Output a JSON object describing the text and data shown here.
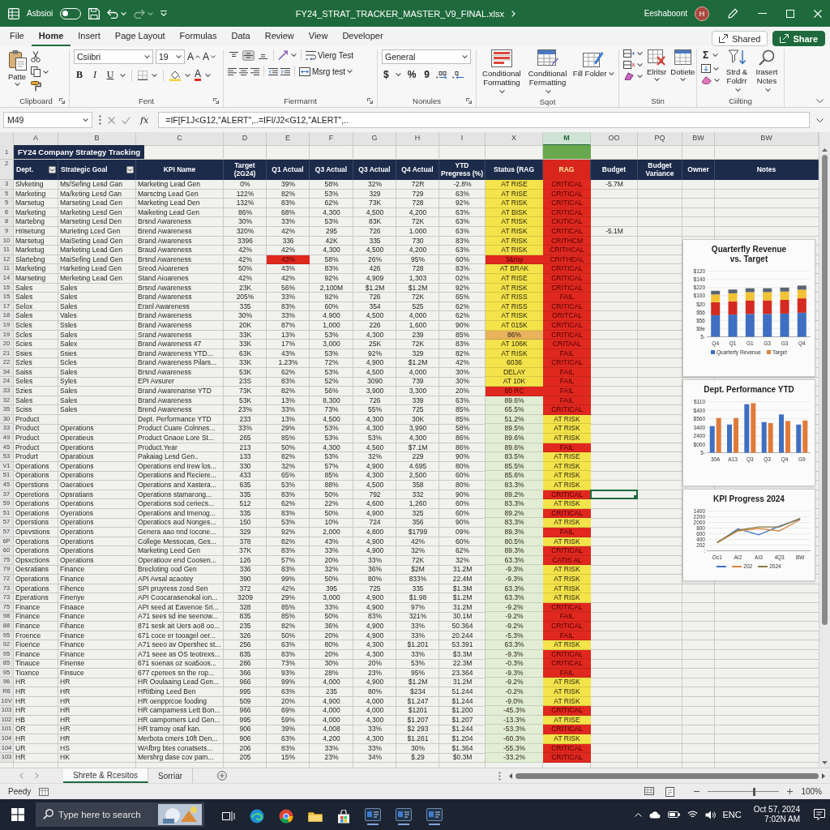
{
  "title_bar": {
    "autosave_label": "Asbsioi",
    "autosave_on": false,
    "file_name": "FY24_STRAT_TRACKER_MASTER_V9_FINAL.xlsx",
    "user_name": "Eeshaboont",
    "avatar_initial": "H"
  },
  "ribbon": {
    "tabs": [
      {
        "label": "File",
        "selected": false
      },
      {
        "label": "Home",
        "selected": true
      },
      {
        "label": "Insert",
        "selected": false
      },
      {
        "label": "Page Layout",
        "selected": false
      },
      {
        "label": "Formulas",
        "selected": false
      },
      {
        "label": "Data",
        "selected": false
      },
      {
        "label": "Review",
        "selected": false
      },
      {
        "label": "View",
        "selected": false
      },
      {
        "label": "Developer",
        "selected": false
      }
    ],
    "shared_label": "Shared",
    "share_label": "Share",
    "clipboard": {
      "label": "Clipboard",
      "paste_label": "Patte"
    },
    "font": {
      "label": "Fent",
      "font_name": "Csiibri",
      "font_size": "19",
      "grow_label": "A",
      "shrink_label": "A",
      "style_buttons": [
        "B",
        "I",
        "U"
      ],
      "color_label": "A"
    },
    "alignment": {
      "label": "Fiermarnt",
      "vertical_options": [
        {
          "selected": false
        },
        {
          "selected": true
        },
        {
          "selected": false
        }
      ],
      "wrap_label": "Vierg Test",
      "merge_label": "Msrg test"
    },
    "number": {
      "label": "Nonules",
      "format": "General",
      "symbols": [
        "$",
        "%",
        "9"
      ]
    },
    "styles": {
      "label": "Sqot",
      "buttons": [
        "Conditional Formatting",
        "Conditional Fermatting",
        "Fill Folder"
      ]
    },
    "cells": {
      "label": "Stin",
      "buttons": [
        "Elritsr",
        "Dotiete"
      ]
    },
    "editing": {
      "label": "Ciilting",
      "sum_label": "Σ",
      "buttons": [
        "Strd & Foldrr",
        "Irasert Nctes"
      ]
    }
  },
  "formula_bar": {
    "name_box": "M49",
    "fx_label": "fx",
    "formula": "=IF[F1J<G12,\"ALERT\",..=IFI/J2<G12,\"ALERT\",.."
  },
  "sheet": {
    "columns": [
      {
        "letter": "A",
        "selected": false
      },
      {
        "letter": "B",
        "selected": false
      },
      {
        "letter": "C",
        "selected": false
      },
      {
        "letter": "D",
        "selected": false
      },
      {
        "letter": "E",
        "selected": false
      },
      {
        "letter": "F",
        "selected": false
      },
      {
        "letter": "G",
        "selected": false
      },
      {
        "letter": "H",
        "selected": false
      },
      {
        "letter": "I",
        "selected": false
      },
      {
        "letter": "X",
        "selected": false
      },
      {
        "letter": "M",
        "selected": true
      },
      {
        "letter": "OO",
        "selected": false
      },
      {
        "letter": "PQ",
        "selected": false
      },
      {
        "letter": "BW",
        "selected": false
      },
      {
        "letter": "BW",
        "selected": false
      }
    ],
    "title_row": {
      "row_number": "1",
      "title": "FY24 Company Strategy Tracking"
    },
    "header_row": {
      "row_number": "2",
      "headers": [
        {
          "label": "Dept.",
          "filter": true,
          "color": "#1c2b4a"
        },
        {
          "label": "Strategic Goal",
          "filter": true,
          "color": "#1c2b4a"
        },
        {
          "label": "KPI Name",
          "filter": false,
          "color": "#1c2b4a"
        },
        {
          "label": "Target (2G24)",
          "filter": false,
          "color": "#1c2b4a"
        },
        {
          "label": "Q1 Actual",
          "filter": false,
          "color": "#1c2b4a"
        },
        {
          "label": "Q3 Actual",
          "filter": false,
          "color": "#1c2b4a"
        },
        {
          "label": "Q3 Actual",
          "filter": false,
          "color": "#1c2b4a"
        },
        {
          "label": "Q4 Actual",
          "filter": false,
          "color": "#1c2b4a"
        },
        {
          "label": "YTD Pregress (%)",
          "filter": false,
          "color": "#1c2b4a"
        },
        {
          "label": "Status (RAG",
          "filter": false,
          "color": "#1c2b4a"
        },
        {
          "label": "RAG",
          "filter": false,
          "color": "#d8261d"
        },
        {
          "label": "Budget",
          "filter": false,
          "color": "#1c2b4a"
        },
        {
          "label": "Budget Variance",
          "filter": false,
          "color": "#1c2b4a"
        },
        {
          "label": "Owner",
          "filter": false,
          "color": "#1c2b4a"
        },
        {
          "label": "Notes",
          "filter": false,
          "color": "#1c2b4a"
        }
      ]
    },
    "rows": [
      {
        "row_number": "3",
        "cells": [
          "Slvketing",
          "Ms/Sefing Lesd Gan",
          "Marketing Lead Gen",
          "0%",
          "39%",
          "58%",
          "32%",
          "72R",
          "-2.8%"
        ],
        "status": {
          "text": "AT RISE",
          "color": "#f4e34a"
        },
        "rag": {
          "text": "CRITICAL",
          "color": "#e0281f"
        },
        "budget": "-5.7M",
        "selected": false
      },
      {
        "row_number": "5",
        "cells": [
          "Marketing",
          "Ma/keting Lesd Gan",
          "Marsctng Lead Gen",
          "122%",
          "82%",
          "53%",
          "329",
          "729",
          "63%"
        ],
        "status": {
          "text": "AT RISE",
          "color": "#f4e34a"
        },
        "rag": {
          "text": "CRITICAL",
          "color": "#e0281f"
        },
        "selected": false
      },
      {
        "row_number": "5",
        "cells": [
          "Marsetug",
          "Marseting Lead Gen",
          "Marketing Lead Den",
          "132%",
          "83%",
          "62%",
          "73K",
          "728",
          "92%"
        ],
        "status": {
          "text": "AT RISK",
          "color": "#f4e34a"
        },
        "rag": {
          "text": "CRITICAL",
          "color": "#e0281f"
        },
        "selected": false
      },
      {
        "row_number": "6",
        "cells": [
          "Marketing",
          "Marketing Lesd Gen",
          "Maiketing Lead Gen",
          "86%",
          "68%",
          "4,300",
          "4,500",
          "4,200",
          "63%"
        ],
        "status": {
          "text": "AT BISK",
          "color": "#f4e34a"
        },
        "rag": {
          "text": "CRITICAL",
          "color": "#e0281f"
        },
        "selected": false
      },
      {
        "row_number": "8",
        "cells": [
          "Martebng",
          "Marseting Lesd Den",
          "Brsnd Awareness",
          "30%",
          "33%",
          "53%",
          "83K",
          "72K",
          "63%"
        ],
        "status": {
          "text": "AT RISK",
          "color": "#f4e34a"
        },
        "rag": {
          "text": "CKITICAL",
          "color": "#e0281f"
        },
        "selected": false
      },
      {
        "row_number": "9",
        "cells": [
          "Hrisetung",
          "Murieting Lced Gen",
          "Brend Awareness",
          "320%",
          "42%",
          "295",
          "726",
          "1.000",
          "63%"
        ],
        "status": {
          "text": "AT RISK",
          "color": "#f4e34a"
        },
        "rag": {
          "text": "CRITICAL",
          "color": "#e0281f"
        },
        "budget": "-5.1M",
        "selected": false
      },
      {
        "row_number": "10",
        "cells": [
          "Marsetug",
          "MaiSeting Lead Gen",
          "Brand Awareness",
          "3396",
          "336",
          "42K",
          "335",
          "730",
          "83%"
        ],
        "status": {
          "text": "AT RISK",
          "color": "#f4e34a"
        },
        "rag": {
          "text": "CRITHCM",
          "color": "#e0281f"
        },
        "selected": false
      },
      {
        "row_number": "11",
        "cells": [
          "Marketug",
          "Marketing Lead Gen",
          "Braud Awareness",
          "42%",
          "42%",
          "4,300",
          "4,500",
          "4,200",
          "63%"
        ],
        "status": {
          "text": "AT RISK",
          "color": "#f4e34a"
        },
        "rag": {
          "text": "CRITHCAL",
          "color": "#e0281f"
        },
        "selected": false
      },
      {
        "row_number": "12",
        "cells": [
          "Slartebng",
          "MaiSefing Lead Gen",
          "Brsnd Awareness",
          "42%",
          {
            "text": "43%",
            "color": "#e0281f"
          },
          "58%",
          "26%",
          "95%",
          "60%"
        ],
        "status": {
          "text": "3&roy",
          "color": "#e0281f"
        },
        "rag": {
          "text": "CRITHEAL",
          "color": "#e0281f"
        },
        "selected": false
      },
      {
        "row_number": "11",
        "cells": [
          "Marketing",
          "Harketing Lead Gen",
          "Sreod Aioarenes",
          "50%",
          "43%",
          "83%",
          "426",
          "728",
          "83%"
        ],
        "status": {
          "text": "AT BRAK",
          "color": "#f4e34a"
        },
        "rag": {
          "text": "CRITICAL",
          "color": "#e0281f"
        },
        "selected": false
      },
      {
        "row_number": "14",
        "cells": [
          "Marseting",
          "Merketing Lead Gen",
          "Stand Aioarenes",
          "42%",
          "42%",
          "92%",
          "4,909",
          "1,303",
          "02%"
        ],
        "status": {
          "text": "AT RISE",
          "color": "#f4e34a"
        },
        "rag": {
          "text": "CRITICAL",
          "color": "#e0281f"
        },
        "selected": false
      },
      {
        "row_number": "15",
        "cells": [
          "Sales",
          "Sales",
          "Brsnd Awareness",
          "23K",
          "56%",
          "2,100M",
          "$1.2M",
          "$1.2M",
          "92%"
        ],
        "status": {
          "text": "AT RISK",
          "color": "#f4e34a"
        },
        "rag": {
          "text": "CRITICAL",
          "color": "#e0281f"
        },
        "selected": false
      },
      {
        "row_number": "15",
        "cells": [
          "Sales",
          "Sales",
          "Brand Awareness",
          "205%",
          "33%",
          "92%",
          "726",
          "72K",
          "65%"
        ],
        "status": {
          "text": "AT RISS",
          "color": "#f4e34a"
        },
        "rag": {
          "text": "FAIL",
          "color": "#e0281f"
        },
        "selected": false
      },
      {
        "row_number": "17",
        "cells": [
          "Selox",
          "Sales",
          "Eranl Awareness",
          "335",
          "83%",
          "60%",
          "354",
          "525",
          "62%"
        ],
        "status": {
          "text": "AT RISS",
          "color": "#f4e34a"
        },
        "rag": {
          "text": "CRITICAL",
          "color": "#e0281f"
        },
        "selected": false
      },
      {
        "row_number": "18",
        "cells": [
          "Sales",
          "Vales",
          "Brand Awareness",
          "30%",
          "33%",
          "4.900",
          "4,500",
          "4,000",
          "62%"
        ],
        "status": {
          "text": "AT RISK",
          "color": "#f4e34a"
        },
        "rag": {
          "text": "ORITCAL",
          "color": "#e0281f"
        },
        "selected": false
      },
      {
        "row_number": "19",
        "cells": [
          "Scles",
          "Ssles",
          "Brand Awareness",
          "20K",
          "87%",
          "1,000",
          "226",
          "1,600",
          "90%"
        ],
        "status": {
          "text": "AT 015K",
          "color": "#f4e34a"
        },
        "rag": {
          "text": "CRITICAL",
          "color": "#e0281f"
        },
        "selected": false
      },
      {
        "row_number": "19",
        "cells": [
          "Scles",
          "Sales",
          "Srand Awareness",
          "33K",
          "13%",
          "53%",
          "4,300",
          "239",
          "85%"
        ],
        "status": {
          "text": "86%",
          "color": "#e9b25c"
        },
        "rag": {
          "text": "CRITICAL",
          "color": "#e0281f"
        },
        "selected": false
      },
      {
        "row_number": "20",
        "cells": [
          "Scies",
          "Salex",
          "Brand Awareness 47",
          "33K",
          "17%",
          "3,000",
          "25K",
          "72K",
          "83%"
        ],
        "status": {
          "text": "AT 106K",
          "color": "#f4e34a"
        },
        "rag": {
          "text": "CRITAAL",
          "color": "#e0281f"
        },
        "selected": false
      },
      {
        "row_number": "21",
        "cells": [
          "Ssies",
          "Ssies",
          "Brand Awareness YTD...",
          "63K",
          "43%",
          "53%",
          "92%",
          "329",
          "82%"
        ],
        "status": {
          "text": "AT RISK",
          "color": "#f4e34a"
        },
        "rag": {
          "text": "FAIL",
          "color": "#e0281f"
        },
        "selected": false
      },
      {
        "row_number": "22",
        "cells": [
          "Szles",
          "Scles",
          "Brand Awareness Pilars...",
          "33K",
          "1.23%",
          "72%",
          "4,900",
          "$1.2M",
          "42%"
        ],
        "status": {
          "text": "6036",
          "color": "#f4e34a"
        },
        "rag": {
          "text": "CRITICAL",
          "color": "#e0281f"
        },
        "selected": false
      },
      {
        "row_number": "34",
        "cells": [
          "Saiss",
          "Sales",
          "Brsnd Awareness",
          "53K",
          "62%",
          "53%",
          "4,500",
          "4,000",
          "30%"
        ],
        "status": {
          "text": "DELAY",
          "color": "#f4e34a"
        },
        "rag": {
          "text": "FAIL",
          "color": "#e0281f"
        },
        "selected": false
      },
      {
        "row_number": "24",
        "cells": [
          "Seles",
          "Syles",
          "EPI Avsurer",
          "23S",
          "83%",
          "52%",
          "3090",
          "739",
          "30%"
        ],
        "status": {
          "text": "AT 10K",
          "color": "#f4e34a"
        },
        "rag": {
          "text": "FAIL",
          "color": "#e0281f"
        },
        "selected": false
      },
      {
        "row_number": "33",
        "cells": [
          "Szies",
          "Sales",
          "Brand Awarenanse YTD",
          "73K",
          "82%",
          "56%",
          "3,900",
          "3,300",
          "20%"
        ],
        "status": {
          "text": "60 RC",
          "color": "#e0281f"
        },
        "rag": {
          "text": "FAIL",
          "color": "#e0281f"
        },
        "selected": false
      },
      {
        "row_number": "32",
        "cells": [
          "Sales",
          "Sales",
          "Brand Awareness",
          "53K",
          "13%",
          "8,300",
          "726",
          "339",
          "63%"
        ],
        "status": {
          "text": "89.6%",
          "color": "#e2edd6"
        },
        "rag": {
          "text": "FAIL",
          "color": "#e0281f"
        },
        "selected": false
      },
      {
        "row_number": "35",
        "cells": [
          "Sciss",
          "Sales",
          "Brend Awareness",
          "23%",
          "33%",
          "73%",
          "55%",
          "725",
          "85%"
        ],
        "status": {
          "text": "65.5%",
          "color": "#e2edd6"
        },
        "rag": {
          "text": "CRITICAL",
          "color": "#e0281f"
        },
        "selected": false
      },
      {
        "row_number": "30",
        "cells": [
          "Product",
          null,
          "Dept. Performance YTD",
          "233",
          "13%",
          "4,500",
          "4,300",
          "30K",
          "85%"
        ],
        "status": {
          "text": "51.2%",
          "color": "#e2edd6"
        },
        "rag": {
          "text": "AT RISK",
          "color": "#f4e34a"
        },
        "selected": false
      },
      {
        "row_number": "33",
        "cells": [
          "Product",
          "Operations",
          "Product Cuare Colnnes...",
          "33%",
          "29%",
          "53%",
          "4,300",
          "3,990",
          "58%"
        ],
        "status": {
          "text": "89.5%",
          "color": "#e2edd6"
        },
        "rag": {
          "text": "AT RISK",
          "color": "#f4e34a"
        },
        "selected": false
      },
      {
        "row_number": "49",
        "cells": [
          "Product",
          "Operatieus",
          "Product Gnaoe Lore St...",
          "265",
          "85%",
          "53%",
          "53%",
          "4,300",
          "86%"
        ],
        "status": {
          "text": "89.6%",
          "color": "#e2edd6"
        },
        "rag": {
          "text": "AT RISK",
          "color": "#f4e34a"
        },
        "selected": false
      },
      {
        "row_number": "45",
        "cells": [
          "Product",
          "Operations",
          "Product.Year",
          "213",
          "50%",
          "4,300",
          "4,560",
          "$7.1M",
          "86%"
        ],
        "status": {
          "text": "89.6%",
          "color": "#e2edd6"
        },
        "rag": {
          "text": "FAIL",
          "color": "#e0281f"
        },
        "selected": false
      },
      {
        "row_number": "53",
        "cells": [
          "Produrt",
          "Oparatious",
          "Pakaiag Lesd Gen..",
          "133",
          "82%",
          "53%",
          "32%",
          "229",
          "90%"
        ],
        "status": {
          "text": "83.5%",
          "color": "#e2edd6"
        },
        "rag": {
          "text": "AT RISE",
          "color": "#f4e34a"
        },
        "selected": false
      },
      {
        "row_number": "V1",
        "cells": [
          "Operations",
          "Operations",
          "Operations end Irew los...",
          "330",
          "32%",
          "57%",
          "4,900",
          "4.695",
          "80%"
        ],
        "status": {
          "text": "85.5%",
          "color": "#e2edd6"
        },
        "rag": {
          "text": "AT RISK",
          "color": "#f4e34a"
        },
        "selected": false
      },
      {
        "row_number": "51",
        "cells": [
          "Operations",
          "Operations",
          "Operations and Reciere...",
          "433",
          "65%",
          "85%",
          "4,300",
          "2,500",
          "60%"
        ],
        "status": {
          "text": "85.6%",
          "color": "#e2edd6"
        },
        "rag": {
          "text": "AT RISK",
          "color": "#f4e34a"
        },
        "selected": false
      },
      {
        "row_number": "45",
        "cells": [
          "Operstions",
          "Oaeratioes",
          "Operations and Xastera...",
          "635",
          "53%",
          "88%",
          "4,500",
          "358",
          "80%"
        ],
        "status": {
          "text": "83.3%",
          "color": "#e2edd6"
        },
        "rag": {
          "text": "AT RISK",
          "color": "#f4e34a"
        },
        "selected": false
      },
      {
        "row_number": "37",
        "cells": [
          "Operetions",
          "Opsratians",
          "Operations stamarong...",
          "335",
          "83%",
          "50%",
          "792",
          "332",
          "90%"
        ],
        "status": {
          "text": "89.2%",
          "color": "#e2edd6"
        },
        "rag": {
          "text": "CRITICAL",
          "color": "#e0281f"
        },
        "selected": true
      },
      {
        "row_number": "59",
        "cells": [
          "Operations",
          "Operations",
          "Operations sod ceriecs...",
          "512",
          "62%",
          "22%",
          "4,600",
          "1,260",
          "60%"
        ],
        "status": {
          "text": "83.3%",
          "color": "#e2edd6"
        },
        "rag": {
          "text": "AT RISK",
          "color": "#f4e34a"
        },
        "selected": false
      },
      {
        "row_number": "51",
        "cells": [
          "Operations",
          "Oyerations",
          "Operations and Imenog...",
          "335",
          "83%",
          "50%",
          "4,900",
          "325",
          "60%"
        ],
        "status": {
          "text": "89.2%",
          "color": "#e2edd6"
        },
        "rag": {
          "text": "CRITICAL",
          "color": "#e0281f"
        },
        "selected": false
      },
      {
        "row_number": "57",
        "cells": [
          "Operstions",
          "Operations",
          "Operatiocs aud Nonges...",
          "150",
          "53%",
          "10%",
          "724",
          "356",
          "90%"
        ],
        "status": {
          "text": "83.3%",
          "color": "#e2edd6"
        },
        "rag": {
          "text": "AT RISK",
          "color": "#f4e34a"
        },
        "selected": false
      },
      {
        "row_number": "57",
        "cells": [
          "Opevstions",
          "Operations",
          "Genera aao nnd Iocone...",
          "329",
          "92%",
          "2,000",
          "4,800",
          "$1799",
          "09%"
        ],
        "status": {
          "text": "89.3%",
          "color": "#e2edd6"
        },
        "rag": {
          "text": "FAIL",
          "color": "#e0281f"
        },
        "selected": false
      },
      {
        "row_number": "6P",
        "cells": [
          "Operations",
          "Operations",
          "College Messocas, Ges...",
          "378",
          "82%",
          "43%",
          "4,900",
          "42%",
          "60%"
        ],
        "status": {
          "text": "80.5%",
          "color": "#e2edd6"
        },
        "rag": {
          "text": "AT RISK",
          "color": "#f4e34a"
        },
        "selected": false
      },
      {
        "row_number": "60",
        "cells": [
          "Operations",
          "Operations",
          "Marketing Leed Gen",
          "37K",
          "83%",
          "33%",
          "4,900",
          "32%",
          "62%"
        ],
        "status": {
          "text": "89.3%",
          "color": "#e2edd6"
        },
        "rag": {
          "text": "CRITICAL",
          "color": "#e0281f"
        },
        "selected": false
      },
      {
        "row_number": "75",
        "cells": [
          "Opsxctions",
          "Operations",
          "Operatioov end Coosen...",
          "126",
          "57%",
          "20%",
          "33%",
          "72K",
          "32%"
        ],
        "status": {
          "text": "63.3%",
          "color": "#e2edd6"
        },
        "rag": {
          "text": "CATIS AL",
          "color": "#e0281f"
        },
        "selected": false
      },
      {
        "row_number": "79",
        "cells": [
          "Oesratians",
          "Finance",
          "Brecloting ood Gen",
          "336",
          "83%",
          "32%",
          "36%",
          "$2M",
          "31.2M"
        ],
        "status": {
          "text": "-9.3%",
          "color": "#e2edd6"
        },
        "rag": {
          "text": "AT RISK",
          "color": "#f4e34a"
        },
        "selected": false
      },
      {
        "row_number": "72",
        "cells": [
          "Operations",
          "Finance",
          "API Avsal acaotey",
          "390",
          "99%",
          "50%",
          "80%",
          "833%",
          "22.4M"
        ],
        "status": {
          "text": "-9.3%",
          "color": "#e2edd6"
        },
        "rag": {
          "text": "AT RISK",
          "color": "#f4e34a"
        },
        "selected": false
      },
      {
        "row_number": "73",
        "cells": [
          "Operations",
          "Fihence",
          "SPI pruyress zosd Sen",
          "372",
          "42%",
          "395",
          "725",
          "335",
          "$1.3M"
        ],
        "status": {
          "text": "63.3%",
          "color": "#e2edd6"
        },
        "rag": {
          "text": "AT RISK",
          "color": "#f4e34a"
        },
        "selected": false
      },
      {
        "row_number": "73",
        "cells": [
          "Eperations",
          "Finenye",
          "API Coocarasenokal ion...",
          "3209",
          "29%",
          "3,000",
          "4,900",
          "$1.98",
          "$1.2M"
        ],
        "status": {
          "text": "63.3%",
          "color": "#e2edd6"
        },
        "rag": {
          "text": "AT RISK",
          "color": "#f4e34a"
        },
        "selected": false
      },
      {
        "row_number": "75",
        "cells": [
          "Finance",
          "Finaace",
          "API seed at Eavenoe Sri...",
          "328",
          "85%",
          "33%",
          "4,900",
          "97%",
          "31.2M"
        ],
        "status": {
          "text": "-9.2%",
          "color": "#e2edd6"
        },
        "rag": {
          "text": "CRITICAL",
          "color": "#e0281f"
        },
        "selected": false
      },
      {
        "row_number": "98",
        "cells": [
          "Finance",
          "Finance",
          "A71 sees sd ine seenow...",
          "835",
          "85%",
          "50%",
          "83%",
          "321%",
          "30.1M"
        ],
        "status": {
          "text": "-9.2%",
          "color": "#e2edd6"
        },
        "rag": {
          "text": "FAIL",
          "color": "#e0281f"
        },
        "selected": false
      },
      {
        "row_number": "88",
        "cells": [
          "Finance",
          "Fihance",
          "871 sesk ait Uers ao8 oo...",
          "235",
          "82%",
          "36%",
          "4,900",
          "33%",
          "50.364"
        ],
        "status": {
          "text": "-9.2%",
          "color": "#e2edd6"
        },
        "rag": {
          "text": "CRITICAL",
          "color": "#e0281f"
        },
        "selected": false
      },
      {
        "row_number": "95",
        "cells": [
          "Froence",
          "Finance",
          "671 coce er tooagel oer...",
          "326",
          "50%",
          "20%",
          "4,900",
          "33%",
          "20.244"
        ],
        "status": {
          "text": "-5.3%",
          "color": "#e2edd6"
        },
        "rag": {
          "text": "FAIL",
          "color": "#e0281f"
        },
        "selected": false
      },
      {
        "row_number": "92",
        "cells": [
          "Fioence",
          "Finance",
          "A71 seeo av Opershec st...",
          "256",
          "63%",
          "80%",
          "4,300",
          "$1.201",
          "53.391"
        ],
        "status": {
          "text": "63.3%",
          "color": "#e2edd6"
        },
        "rag": {
          "text": "AT RISK",
          "color": "#f4e34a"
        },
        "selected": false
      },
      {
        "row_number": "95",
        "cells": [
          "Finance",
          "Finance",
          "A71 seee as OS teotrexs...",
          "835",
          "83%",
          "20%",
          "4,300",
          "33%",
          "$3.3M"
        ],
        "status": {
          "text": "-9.3%",
          "color": "#e2edd6"
        },
        "rag": {
          "text": "CRITICAL",
          "color": "#e0281f"
        },
        "selected": false
      },
      {
        "row_number": "85",
        "cells": [
          "Tinauce",
          "Finense",
          "671 soenas oz soa5oos...",
          "286",
          "73%",
          "30%",
          "20%",
          "53%",
          "22.3M"
        ],
        "status": {
          "text": "-0.3%",
          "color": "#e2edd6"
        },
        "rag": {
          "text": "CRITICAL",
          "color": "#e0281f"
        },
        "selected": false
      },
      {
        "row_number": "95",
        "cells": [
          "Tioxnce",
          "Finsuce",
          "677 cperees sn the rop...",
          "366",
          "93%",
          "28%",
          "23%",
          "95%",
          "23.364"
        ],
        "status": {
          "text": "-9.3%",
          "color": "#e2edd6"
        },
        "rag": {
          "text": "FAIL",
          "color": "#e0281f"
        },
        "selected": false
      },
      {
        "row_number": "96",
        "cells": [
          "HR",
          "HR",
          "HR Ooulaaing Lead Gen...",
          "966",
          "99%",
          "4,000",
          "4,900",
          "$1.2M",
          "31.2M"
        ],
        "status": {
          "text": "-9.2%",
          "color": "#e2edd6"
        },
        "rag": {
          "text": "AT RISK",
          "color": "#f4e34a"
        },
        "selected": false
      },
      {
        "row_number": "R6",
        "cells": [
          "HR",
          "HR",
          "HRitbing Leed Ben",
          "995",
          "63%",
          "235",
          "80%",
          "$234",
          "51.244"
        ],
        "status": {
          "text": "-0.2%",
          "color": "#e2edd6"
        },
        "rag": {
          "text": "AT RISK",
          "color": "#f4e34a"
        },
        "selected": false
      },
      {
        "row_number": "10V",
        "cells": [
          "HR",
          "HR",
          "HR oenpprcoe fooding",
          "509",
          "20%",
          "4,900",
          "4,000",
          "$1.247",
          "$1.244"
        ],
        "status": {
          "text": "-9.0%",
          "color": "#e2edd6"
        },
        "rag": {
          "text": "AT RISK",
          "color": "#f4e34a"
        },
        "selected": false
      },
      {
        "row_number": "103",
        "cells": [
          "HR",
          "HR",
          "HR campamess Lett Bon...",
          "966",
          "69%",
          "4,000",
          "4,000",
          "$1201",
          "$1.200"
        ],
        "status": {
          "text": "-45.3%",
          "color": "#e2edd6"
        },
        "rag": {
          "text": "CRITICAL",
          "color": "#e0281f"
        },
        "selected": false
      },
      {
        "row_number": "102",
        "cells": [
          "HB",
          "HR",
          "HR oampomers Led Gen...",
          "995",
          "59%",
          "4,000",
          "4,300",
          "$1.207",
          "$1.207"
        ],
        "status": {
          "text": "-13.3%",
          "color": "#e2edd6"
        },
        "rag": {
          "text": "AT RISE",
          "color": "#f4e34a"
        },
        "selected": false
      },
      {
        "row_number": "101",
        "cells": [
          "OR",
          "HR",
          "HR tramoy osaf kan.",
          "906",
          "39%",
          "4,008",
          "33%",
          "$2 293",
          "$1.244"
        ],
        "status": {
          "text": "-53.3%",
          "color": "#e2edd6"
        },
        "rag": {
          "text": "CRITICAL",
          "color": "#e0281f"
        },
        "selected": false
      },
      {
        "row_number": "104",
        "cells": [
          "HR",
          "HR",
          "Merbota cmers 10ft Den...",
          "906",
          "63%",
          "4,200",
          "4,300",
          "$1.261",
          "$1.204"
        ],
        "status": {
          "text": "-60.3%",
          "color": "#e2edd6"
        },
        "rag": {
          "text": "AT RISK",
          "color": "#f4e34a"
        },
        "selected": false
      },
      {
        "row_number": "104",
        "cells": [
          "UR",
          "HS",
          "WAfbrg btes conatsets...",
          "206",
          "83%",
          "33%",
          "33%",
          "30%",
          "$1.364"
        ],
        "status": {
          "text": "-55.3%",
          "color": "#e2edd6"
        },
        "rag": {
          "text": "CRITICAL",
          "color": "#e0281f"
        },
        "selected": false
      },
      {
        "row_number": "103",
        "cells": [
          "HR",
          "HK",
          "Mershrg dase cov pam...",
          "205",
          "15%",
          "23%",
          "34%",
          "$.29",
          "$0.3M"
        ],
        "status": {
          "text": "-33.2%",
          "color": "#e2edd6"
        },
        "rag": {
          "text": "CRITICAL",
          "color": "#e0281f"
        },
        "selected": false
      }
    ],
    "charts": [
      {
        "kind": "stacked_bar",
        "title": "Quarterfly Revenue vs. Target",
        "y_labels": [
          "$120",
          "$140",
          "$220",
          "$100",
          "$20",
          "$56",
          "$56",
          "$9e",
          "5-"
        ],
        "x_labels": [
          "Q4",
          "Q1",
          "G1",
          "G3",
          "G3",
          "Q4"
        ],
        "legend": [
          {
            "label": "Quarterfy Revenue",
            "color": "#3f6fc2"
          },
          {
            "label": "Target",
            "color": "#e0843a"
          }
        ]
      },
      {
        "kind": "grouped_bar",
        "title": "Dept. Performance YTD",
        "y_labels": [
          "$110",
          "$400",
          "$560",
          "3400",
          "2400",
          "$000",
          "5-"
        ],
        "x_labels": [
          "30A",
          "A13",
          "Q3",
          "Q3",
          "Q4",
          "G9"
        ]
      },
      {
        "kind": "line",
        "title": "KPI Progress 2024",
        "y_labels": [
          "1400",
          "2200",
          "2000",
          "800",
          "600",
          "400",
          "202",
          ":"
        ],
        "x_labels": [
          "Oc1",
          "AI2",
          "AI3",
          "4Q3",
          "BW"
        ],
        "legend": [
          {
            "color": "#3f6fc2"
          },
          {
            "label": "202",
            "color": "#d9843a"
          },
          {
            "label": "2024",
            "color": "#8a7a42"
          }
        ]
      }
    ]
  },
  "sheet_tabs": {
    "tabs": [
      {
        "label": "Shrete & Rcesitos",
        "selected": true
      },
      {
        "label": "Sorriar",
        "selected": false
      }
    ]
  },
  "status_bar": {
    "status": "Peedy",
    "zoom": {
      "level": 0.65,
      "reading": "100%"
    }
  },
  "taskbar": {
    "search": {
      "placeholder": "Type here to search"
    },
    "language": "ENC",
    "date": "Oct 57, 2024",
    "time": "7:02N AM"
  }
}
